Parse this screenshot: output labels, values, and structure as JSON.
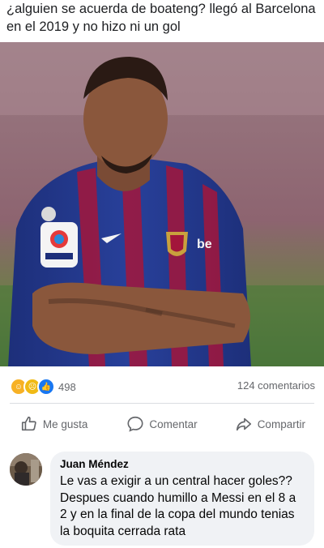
{
  "post": {
    "text": "¿alguien se acuerda de boateng? llegó al Barcelona en el 2019 y no hizo ni un gol"
  },
  "reactions": {
    "icons": [
      "haha-icon",
      "sad-icon",
      "like-icon"
    ],
    "count": "498",
    "comments": "124 comentarios"
  },
  "actions": {
    "like": "Me gusta",
    "comment": "Comentar",
    "share": "Compartir"
  },
  "comment": {
    "author": "Juan Méndez",
    "text": "Le vas a exigir a un central hacer goles?? Despues cuando humillo a Messi en el 8 a 2 y en la final de la copa del mundo tenias la boquita cerrada rata"
  },
  "colors": {
    "link_blue": "#1877f2",
    "meta_gray": "#65676b",
    "bubble_bg": "#f0f2f5"
  }
}
